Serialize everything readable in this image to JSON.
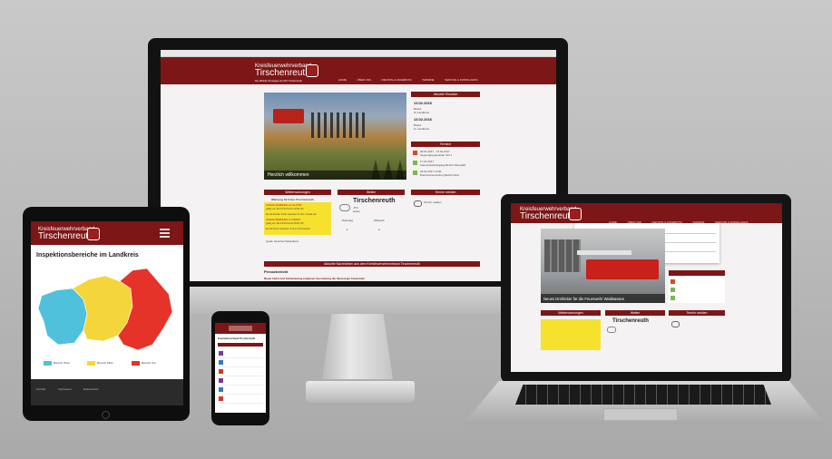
{
  "brand": {
    "kicker": "Kreisfeuerwehrverband",
    "name": "Tirschenreuth",
    "tagline": "Die offizielle Homepage der KFV Tirschenreuth"
  },
  "nav": [
    "HOME",
    "ÜBER UNS",
    "DIENSTE & ANGEBOTE",
    "TERMINE",
    "SERVICE & DOWNLOADS"
  ],
  "desktop": {
    "hero_caption": "Herzlich willkommen",
    "news_heading": "Aktuelle Einsätze",
    "news": [
      {
        "date": "13.02.2016",
        "line1": "Brand",
        "line2": "im Landkreis"
      },
      {
        "date": "13.02.2016",
        "line1": "Brand",
        "line2": "im Landkreis"
      }
    ],
    "termine_heading": "Termine",
    "termine": [
      "09.01.2017 - 13.01.2017",
      "Jugendgruppenleiter Teil 1",
      "17.01.2017",
      "Atemschutzlehrgang Bezirk Oberpfalz",
      "23.01.2017 14:00",
      "Dienstversammlung Bezirk Nord"
    ],
    "box1_heading": "Wetterwarnungen",
    "box1_lines": [
      "Warnung für Kreis Tirschenreuth",
      "Amtliche WARNUNG vor GLÄTTE",
      "gültig von Mo 07:00 bis Di 10:00 Uhr",
      "Es tritt leichter Frost zwischen 0 und -4 Grad auf",
      "Amtliche WARNUNG vor FROST",
      "gültig von Mo 19:00 bis Di 09:00 Uhr",
      "Es tritt Frost zwischen -5 und -10 Grad auf"
    ],
    "box1_footer": "Quelle: Deutscher Wetterdienst",
    "box2_heading": "Wetter",
    "weather": {
      "city": "Tirschenreuth",
      "temp": "-8°C",
      "desc": "Heiter",
      "day1": "Dienstag",
      "day2": "Mittwoch",
      "t1": "-1",
      "t2": "-3"
    },
    "box3_heading": "Termin melden",
    "box3_text": "Termin melden",
    "bottom_heading": "Aktuelle Nachrichten aus dem Kreisfeuerwehrverband Tirschenreuth",
    "press_title": "Pressebericht",
    "press_line": "Neuer Helm und Schutzanzug ergänzen Ausrüstung der Neusorger Feuerwehr"
  },
  "tablet": {
    "map_title": "Inspektionsbereiche im Landkreis",
    "legend": [
      "Bereich West",
      "Bereich Mitte",
      "Bereich Ost"
    ],
    "legend_colors": [
      "#4fc1dd",
      "#f4d63a",
      "#e5332a"
    ],
    "footer_links": [
      "Kontakt",
      "Impressum",
      "Datenschutz"
    ]
  },
  "phone": {
    "section_title": "Feuerwehrverband Tirschenreuth"
  },
  "laptop": {
    "hero_caption": "Neues Drehleiter für die Feuerwehr Waldsassen",
    "box1_heading": "Wetterwarnungen",
    "box2_heading": "Wetter",
    "box3_heading": "Termin melden",
    "weather_city": "Tirschenreuth"
  }
}
